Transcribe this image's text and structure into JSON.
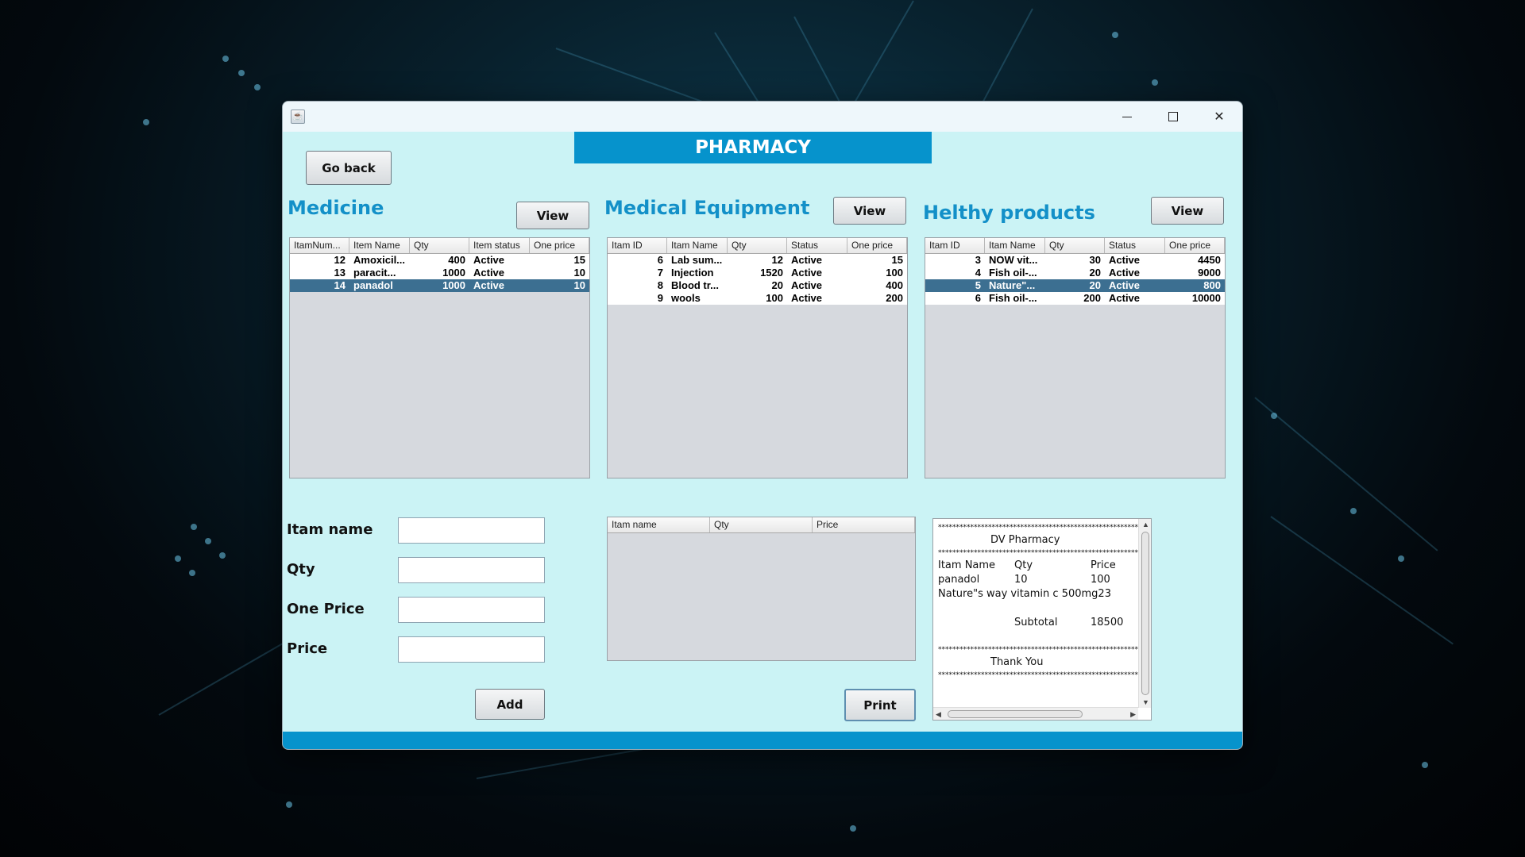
{
  "window": {
    "title_icon": "java-cup-icon"
  },
  "header": {
    "title": "PHARMACY"
  },
  "buttons": {
    "go_back": "Go back",
    "view": "View",
    "add": "Add",
    "print": "Print"
  },
  "medicine": {
    "title": "Medicine",
    "columns": [
      "ItamNum...",
      "Item Name",
      "Qty",
      "Item status",
      "One price"
    ],
    "rows": [
      [
        "12",
        "Amoxicil...",
        "400",
        "Active",
        "15"
      ],
      [
        "13",
        "paracit...",
        "1000",
        "Active",
        "10"
      ],
      [
        "14",
        "panadol",
        "1000",
        "Active",
        "10"
      ]
    ],
    "selected_row": 2
  },
  "equipment": {
    "title": "Medical Equipment",
    "columns": [
      "Itam ID",
      "Itam Name",
      "Qty",
      "Status",
      "One price"
    ],
    "rows": [
      [
        "6",
        "Lab sum...",
        "12",
        "Active",
        "15"
      ],
      [
        "7",
        "Injection",
        "1520",
        "Active",
        "100"
      ],
      [
        "8",
        "Blood tr...",
        "20",
        "Active",
        "400"
      ],
      [
        "9",
        "wools",
        "100",
        "Active",
        "200"
      ]
    ],
    "selected_row": -1
  },
  "healthy": {
    "title": "Helthy products",
    "columns": [
      "Itam ID",
      "Itam Name",
      "Qty",
      "Status",
      "One price"
    ],
    "rows": [
      [
        "3",
        "NOW vit...",
        "30",
        "Active",
        "4450"
      ],
      [
        "4",
        "Fish oil-...",
        "20",
        "Active",
        "9000"
      ],
      [
        "5",
        "Nature\"...",
        "20",
        "Active",
        "800"
      ],
      [
        "6",
        "Fish oil-...",
        "200",
        "Active",
        "10000"
      ]
    ],
    "selected_row": 2
  },
  "form": {
    "item_name_label": "Itam name",
    "qty_label": "Qty",
    "one_price_label": "One Price",
    "price_label": "Price",
    "item_name_value": "",
    "qty_value": "",
    "one_price_value": "",
    "price_value": ""
  },
  "cart": {
    "columns": [
      "Itam name",
      "Qty",
      "Price"
    ]
  },
  "receipt": {
    "stars": "*********************************************************",
    "store": "DV Pharmacy",
    "col_name": "Itam Name",
    "col_qty": "Qty",
    "col_price": "Price",
    "line1_name": "panadol",
    "line1_qty": "10",
    "line1_price": "100",
    "line2_text": "Nature\"s way vitamin c 500mg23",
    "subtotal_label": "Subtotal",
    "subtotal_value": "18500",
    "thank_you": "Thank You"
  }
}
